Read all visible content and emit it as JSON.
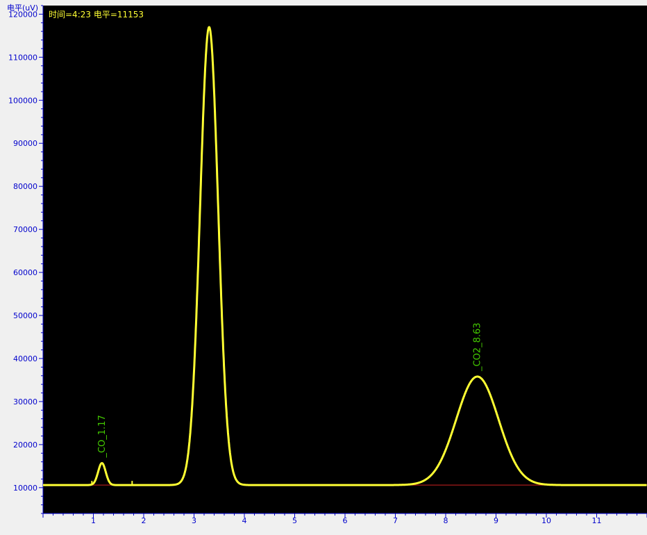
{
  "status_readout": "时间=4:23 电平=11153",
  "colors": {
    "background": "#000000",
    "frame": "#f0f0f0",
    "axis": "#0000cc",
    "trace": "#ffff33",
    "baseline": "#cc2222",
    "peak_label": "#44cc00",
    "readout": "#ffff33"
  },
  "chart_data": {
    "type": "line",
    "title": "",
    "xlabel": "",
    "ylabel": "电平(uV)",
    "xlim": [
      0,
      12
    ],
    "ylim": [
      4000,
      122000
    ],
    "x_ticks": [
      "1",
      "2",
      "3",
      "4",
      "5",
      "6",
      "7",
      "8",
      "9",
      "10",
      "11"
    ],
    "y_ticks": [
      "10000",
      "20000",
      "30000",
      "40000",
      "50000",
      "60000",
      "70000",
      "80000",
      "90000",
      "100000",
      "110000",
      "120000"
    ],
    "baseline_level": 10600,
    "peaks": [
      {
        "name": "CO",
        "label": "_CO_1.17",
        "retention_time": 1.17,
        "height": 15700,
        "width": 0.075
      },
      {
        "name": "",
        "label": "",
        "retention_time": 3.3,
        "height": 117000,
        "width": 0.18
      },
      {
        "name": "CO2",
        "label": "_CO2_8.63",
        "retention_time": 8.63,
        "height": 35800,
        "width": 0.42
      }
    ],
    "grid": false
  }
}
